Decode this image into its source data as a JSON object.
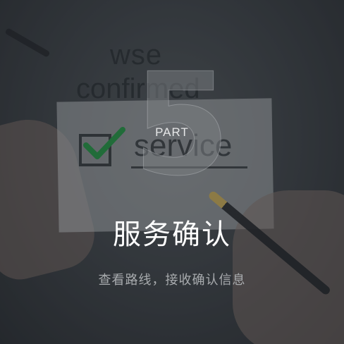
{
  "background": {
    "handwriting_lines": [
      "wse",
      "confirmed",
      "service"
    ]
  },
  "badge": {
    "number": "5",
    "part_label": "PART"
  },
  "title": "服务确认",
  "subtitle": "查看路线，接收确认信息",
  "colors": {
    "title": "#ffffff",
    "subtitle": "#a8abae",
    "check": "#1e8f3e"
  }
}
